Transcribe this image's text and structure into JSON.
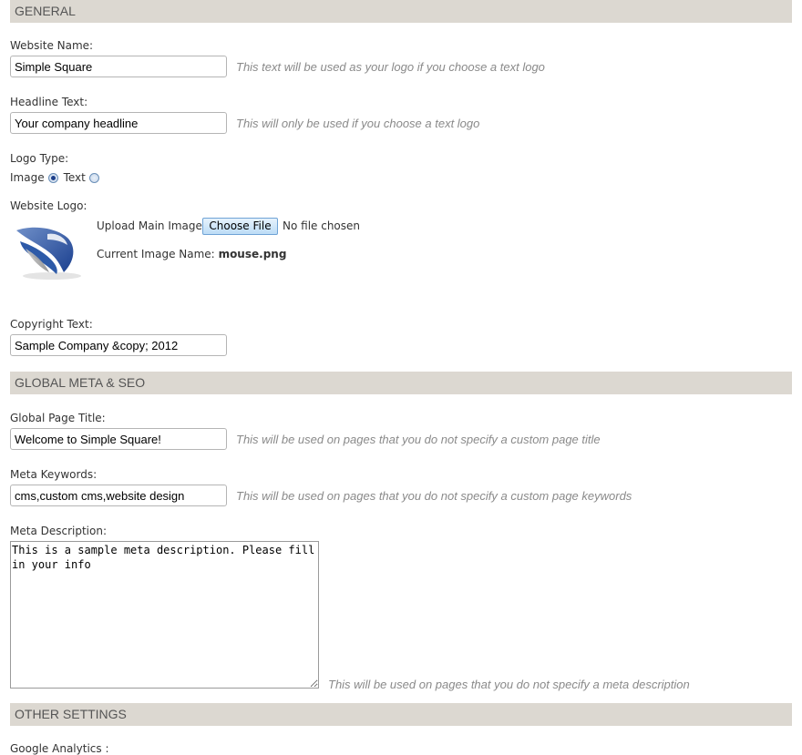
{
  "sections": {
    "general": "GENERAL",
    "global_meta": "GLOBAL META & SEO",
    "other_settings": "OTHER SETTINGS"
  },
  "general": {
    "website_name": {
      "label": "Website Name:",
      "value": "Simple Square",
      "hint": "This text will be used as your logo if you choose a text logo"
    },
    "headline": {
      "label": "Headline Text:",
      "value": "Your company headline",
      "hint": "This will only be used if you choose a text logo"
    },
    "logo_type": {
      "label": "Logo Type:",
      "option_image": "Image",
      "option_text": "Text",
      "selected": "Image"
    },
    "website_logo": {
      "label": "Website Logo:",
      "upload_label": "Upload Main Image",
      "choose_button": "Choose File",
      "no_file": "No file chosen",
      "current_label": "Current Image Name:",
      "current_file": "mouse.png"
    },
    "copyright": {
      "label": "Copyright Text:",
      "value": "Sample Company &copy; 2012"
    }
  },
  "meta": {
    "page_title": {
      "label": "Global Page Title:",
      "value": "Welcome to Simple Square!",
      "hint": "This will be used on pages that you do not specify a custom page title"
    },
    "keywords": {
      "label": "Meta Keywords:",
      "value": "cms,custom cms,website design",
      "hint": "This will be used on pages that you do not specify a custom page keywords"
    },
    "description": {
      "label": "Meta Description:",
      "value": "This is a sample meta description. Please fill in your info",
      "hint": "This will be used on pages that you do not specify a meta description"
    }
  },
  "other": {
    "google_analytics_label": "Google Analytics :"
  },
  "colors": {
    "section_bg": "#dcd8d1",
    "hint_text": "#8a8a8a",
    "logo_blue": "#1f4a9c"
  },
  "icons": {
    "logo": "swoosh-logo-image"
  }
}
